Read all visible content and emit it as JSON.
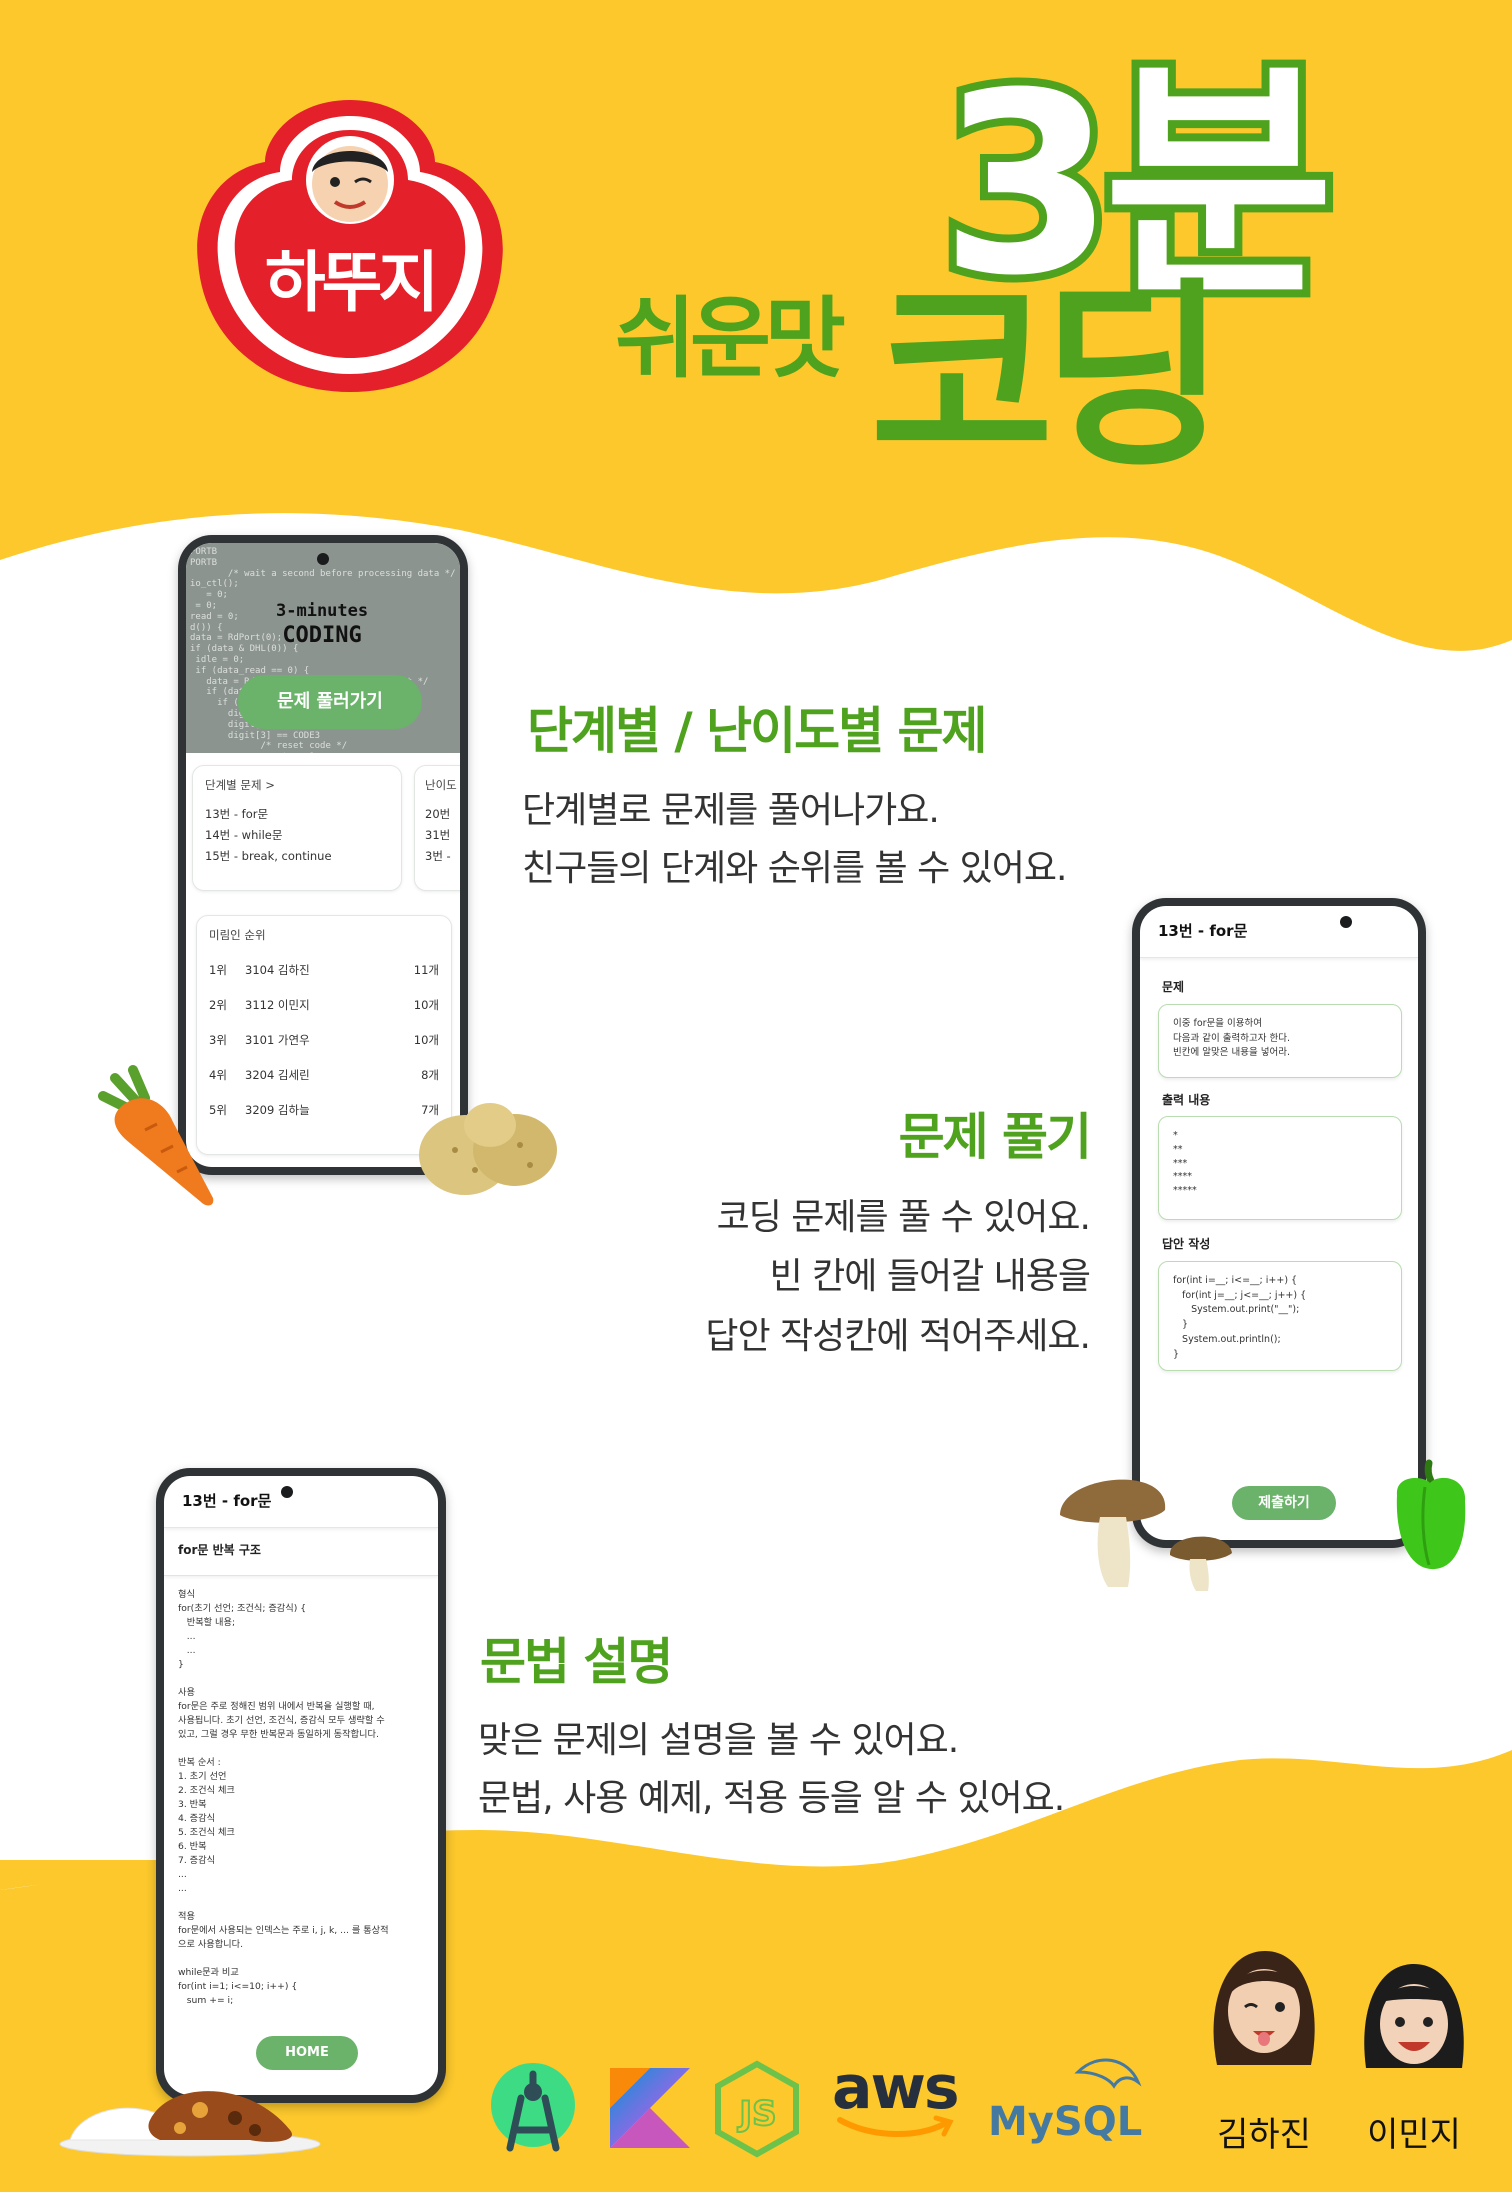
{
  "brand": {
    "logo_text": "하뚜지"
  },
  "title": {
    "main": "3분",
    "sub": "쉬운맛",
    "coding": "코딩"
  },
  "features": [
    {
      "title": "단계별 / 난이도별 문제",
      "lines": [
        "단계별로 문제를 풀어나가요.",
        "친구들의 단계와 순위를 볼 수 있어요."
      ]
    },
    {
      "title": "문제 풀기",
      "lines": [
        "코딩 문제를 풀 수 있어요.",
        "빈 칸에 들어갈 내용을",
        "답안 작성칸에 적어주세요."
      ]
    },
    {
      "title": "문법 설명",
      "lines": [
        "맞은 문제의 설명을 볼 수 있어요.",
        "문법, 사용 예제, 적용 등을 알 수 있어요."
      ]
    }
  ],
  "phone1": {
    "hero_logo_line1": "3-minutes",
    "hero_logo_line2": "CODING",
    "hero_button": "문제 풀러가기",
    "step_card": {
      "header": "단계별 문제 >",
      "items": [
        "13번 - for문",
        "14번 - while문",
        "15번 - break, continue"
      ]
    },
    "level_card": {
      "header": "난이도",
      "items": [
        "20번",
        "31번",
        "3번 -"
      ]
    },
    "ranking": {
      "header": "미림인 순위",
      "rows": [
        {
          "rank": "1위",
          "name": "3104 김하진",
          "count": "11개"
        },
        {
          "rank": "2위",
          "name": "3112 이민지",
          "count": "10개"
        },
        {
          "rank": "3위",
          "name": "3101 가연우",
          "count": "10개"
        },
        {
          "rank": "4위",
          "name": "3204 김세린",
          "count": "8개"
        },
        {
          "rank": "5위",
          "name": "3209 김하늘",
          "count": "7개"
        }
      ]
    }
  },
  "phone2": {
    "title": "13번 - for문",
    "problem_label": "문제",
    "problem_text": "이중 for문을 이용하여\n다음과 같이 출력하고자 한다.\n빈칸에 알맞은 내용을 넣어라.",
    "output_label": "출력 내용",
    "output_text": "*\n**\n***\n****\n*****",
    "answer_label": "답안 작성",
    "answer_text": "for(int i=__; i<=__; i++) {\n   for(int j=__; j<=__; j++) {\n      System.out.print(\"__\");\n   }\n   System.out.println();\n}",
    "submit": "제출하기"
  },
  "phone3": {
    "title": "13번 - for문",
    "section": "for문 반복 구조",
    "body": "형식\nfor(초기 선언; 조건식; 증감식) {\n   반복할 내용;\n   ...\n   ...\n}\n\n사용\nfor문은 주로 정해진 범위 내에서 반복을 실행할 때,\n사용됩니다. 초기 선언, 조건식, 증감식 모두 생략할 수\n있고, 그럴 경우 무한 반복문과 동일하게 동작합니다.\n\n반복 순서 :\n1. 초기 선언\n2. 조건식 체크\n3. 반복\n4. 증감식\n5. 조건식 체크\n6. 반복\n7. 증감식\n...\n...\n\n적용\nfor문에서 사용되는 인덱스는 주로 i, j, k, ... 를 통상적\n으로 사용합니다.\n\nwhile문과 비교\nfor(int i=1; i<=10; i++) {\n   sum += i;",
    "home": "HOME"
  },
  "tech_logos": [
    "android-studio-icon",
    "kotlin-icon",
    "nodejs-icon",
    "aws-icon",
    "mysql-icon"
  ],
  "aws_text": "aws",
  "mysql_text": "MySQL",
  "members": [
    "김하진",
    "이민지"
  ],
  "colors": {
    "yellow": "#fcc82c",
    "green": "#4fa21e",
    "red": "#e4202a",
    "button_green": "#6bb26a"
  }
}
